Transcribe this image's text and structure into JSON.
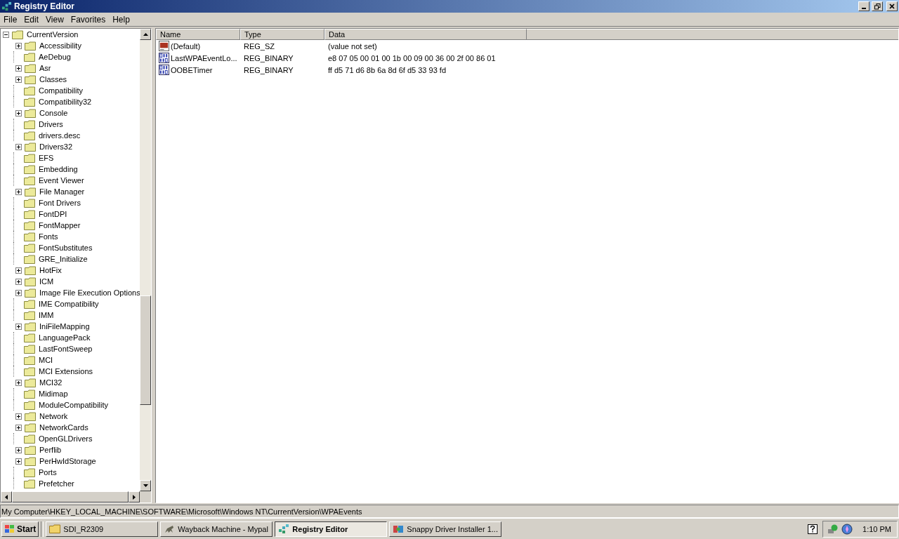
{
  "window": {
    "title": "Registry Editor"
  },
  "menu": [
    "File",
    "Edit",
    "View",
    "Favorites",
    "Help"
  ],
  "tree": {
    "label": "CurrentVersion",
    "expanded": true,
    "children": [
      {
        "label": "Accessibility",
        "has_children": true
      },
      {
        "label": "AeDebug",
        "has_children": false
      },
      {
        "label": "Asr",
        "has_children": true
      },
      {
        "label": "Classes",
        "has_children": true
      },
      {
        "label": "Compatibility",
        "has_children": false
      },
      {
        "label": "Compatibility32",
        "has_children": false
      },
      {
        "label": "Console",
        "has_children": true
      },
      {
        "label": "Drivers",
        "has_children": false
      },
      {
        "label": "drivers.desc",
        "has_children": false
      },
      {
        "label": "Drivers32",
        "has_children": true
      },
      {
        "label": "EFS",
        "has_children": false
      },
      {
        "label": "Embedding",
        "has_children": false
      },
      {
        "label": "Event Viewer",
        "has_children": false
      },
      {
        "label": "File Manager",
        "has_children": true
      },
      {
        "label": "Font Drivers",
        "has_children": false
      },
      {
        "label": "FontDPI",
        "has_children": false
      },
      {
        "label": "FontMapper",
        "has_children": false
      },
      {
        "label": "Fonts",
        "has_children": false
      },
      {
        "label": "FontSubstitutes",
        "has_children": false
      },
      {
        "label": "GRE_Initialize",
        "has_children": false
      },
      {
        "label": "HotFix",
        "has_children": true
      },
      {
        "label": "ICM",
        "has_children": true
      },
      {
        "label": "Image File Execution Options",
        "has_children": true
      },
      {
        "label": "IME Compatibility",
        "has_children": false
      },
      {
        "label": "IMM",
        "has_children": false
      },
      {
        "label": "IniFileMapping",
        "has_children": true
      },
      {
        "label": "LanguagePack",
        "has_children": false
      },
      {
        "label": "LastFontSweep",
        "has_children": false
      },
      {
        "label": "MCI",
        "has_children": false
      },
      {
        "label": "MCI Extensions",
        "has_children": false
      },
      {
        "label": "MCI32",
        "has_children": true
      },
      {
        "label": "Midimap",
        "has_children": false
      },
      {
        "label": "ModuleCompatibility",
        "has_children": false
      },
      {
        "label": "Network",
        "has_children": true
      },
      {
        "label": "NetworkCards",
        "has_children": true
      },
      {
        "label": "OpenGLDrivers",
        "has_children": false
      },
      {
        "label": "Perflib",
        "has_children": true
      },
      {
        "label": "PerHwIdStorage",
        "has_children": true
      },
      {
        "label": "Ports",
        "has_children": false
      },
      {
        "label": "Prefetcher",
        "has_children": false
      }
    ]
  },
  "table": {
    "columns": [
      "Name",
      "Type",
      "Data"
    ],
    "rows": [
      {
        "kind": "string",
        "name": "(Default)",
        "type": "REG_SZ",
        "data": "(value not set)"
      },
      {
        "kind": "binary",
        "name": "LastWPAEventLo...",
        "type": "REG_BINARY",
        "data": "e8 07 05 00 01 00 1b 00 09 00 36 00 2f 00 86 01"
      },
      {
        "kind": "binary",
        "name": "OOBETimer",
        "type": "REG_BINARY",
        "data": "ff d5 71 d6 8b 6a 8d 6f d5 33 93 fd"
      }
    ]
  },
  "status_bar": "My Computer\\HKEY_LOCAL_MACHINE\\SOFTWARE\\Microsoft\\Windows NT\\CurrentVersion\\WPAEvents",
  "taskbar": {
    "start": "Start",
    "tasks": [
      {
        "kind": "folder",
        "label": "SDI_R2309",
        "selected": false
      },
      {
        "kind": "browser",
        "label": "Wayback Machine - Mypal",
        "selected": false
      },
      {
        "kind": "registry",
        "label": "Registry Editor",
        "selected": true
      },
      {
        "kind": "installer",
        "label": "Snappy Driver Installer 1...",
        "selected": false
      }
    ],
    "clock": "1:10 PM"
  }
}
